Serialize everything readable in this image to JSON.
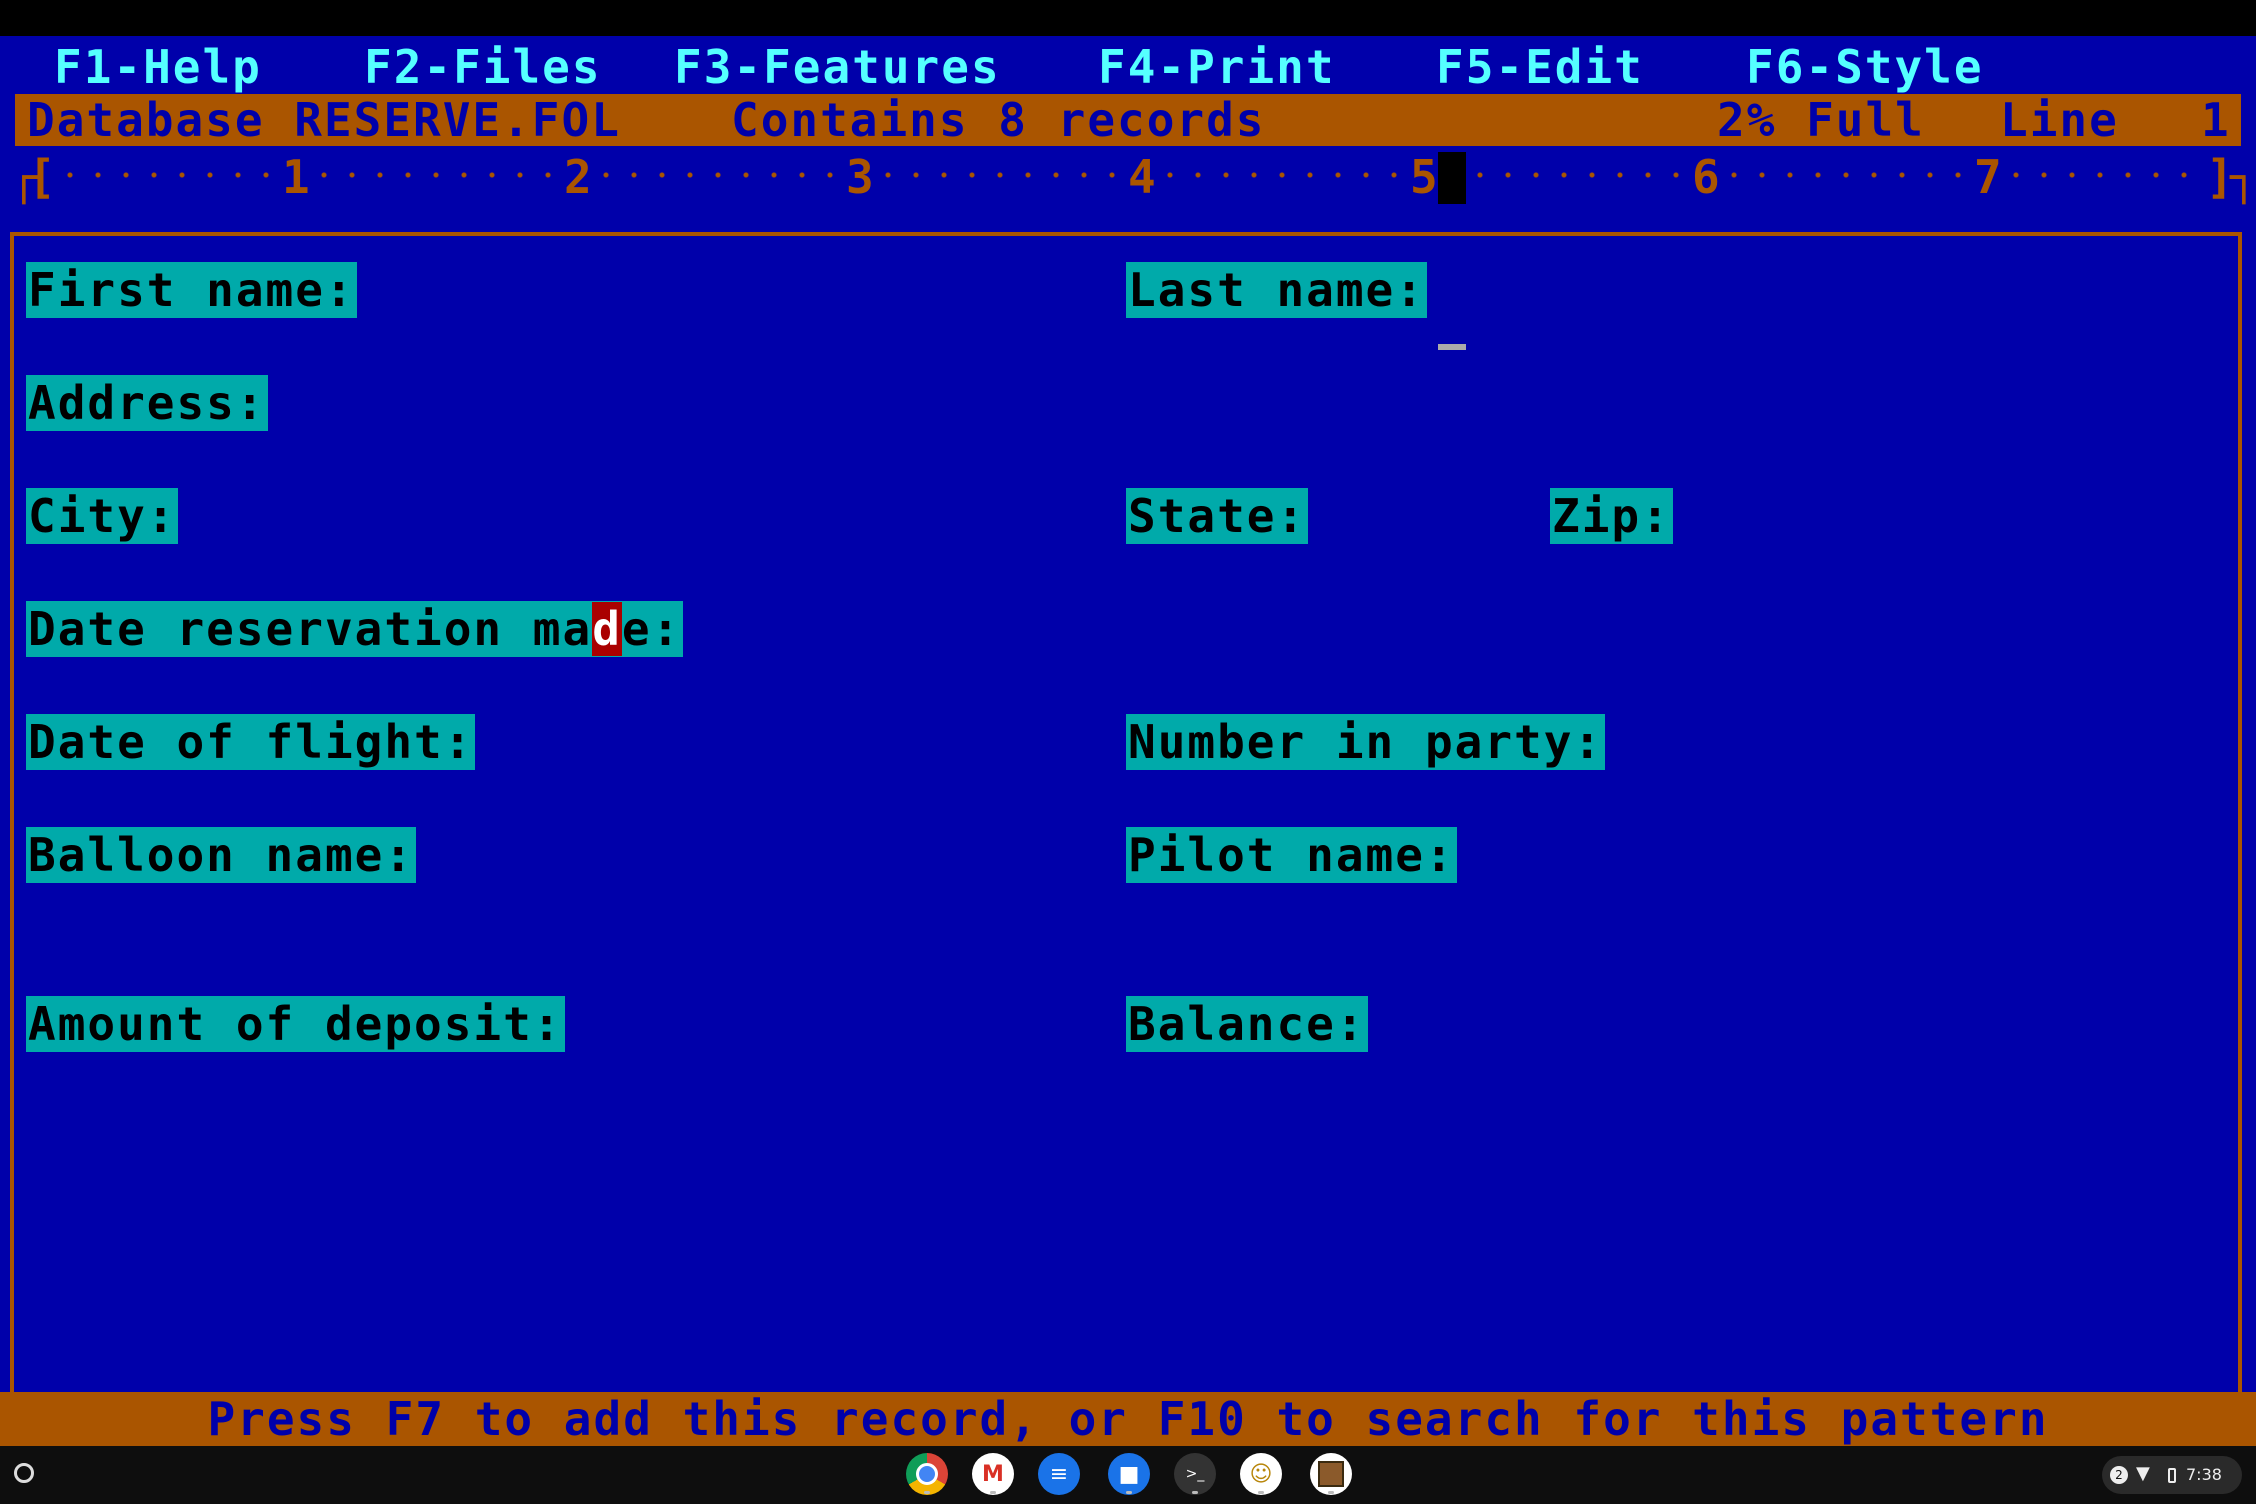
{
  "menu": {
    "items": [
      "F1-Help",
      "F2-Files",
      "F3-Features",
      "F4-Print",
      "F5-Edit",
      "F6-Style"
    ]
  },
  "status": {
    "database": "Database RESERVE.FOL",
    "records": "Contains 8 records",
    "fill": "2% Full",
    "line_label": "Line",
    "line_number": "1"
  },
  "ruler": {
    "open": "[",
    "close": "]",
    "marks": [
      "1",
      "2",
      "3",
      "4",
      "5",
      "6",
      "7"
    ],
    "cursor_column": "5"
  },
  "form": {
    "first_name": "First name:",
    "last_name": "Last name:",
    "address": "Address:",
    "city": "City:",
    "state": "State:",
    "zip": "Zip:",
    "date_made_pre": "Date reservation ma",
    "date_made_hl": "d",
    "date_made_post": "e:",
    "date_flight": "Date of flight:",
    "number_party": "Number in party:",
    "balloon_name": "Balloon name:",
    "pilot_name": "Pilot name:",
    "deposit": "Amount of deposit:",
    "balance": "Balance:"
  },
  "prompt": "Press F7 to add this record, or F10 to search for this pattern",
  "shelf": {
    "apps": [
      "chrome-icon",
      "gmail-icon",
      "messages-icon",
      "files-icon",
      "terminal-icon",
      "dosbox-icon",
      "app-icon"
    ],
    "notification_count": "2",
    "time": "7:38"
  },
  "colors": {
    "background": "#0000aa",
    "menu_text": "#55ffff",
    "status_bar": "#aa5500",
    "field_label_bg": "#00aaaa",
    "highlight": "#aa0000"
  }
}
